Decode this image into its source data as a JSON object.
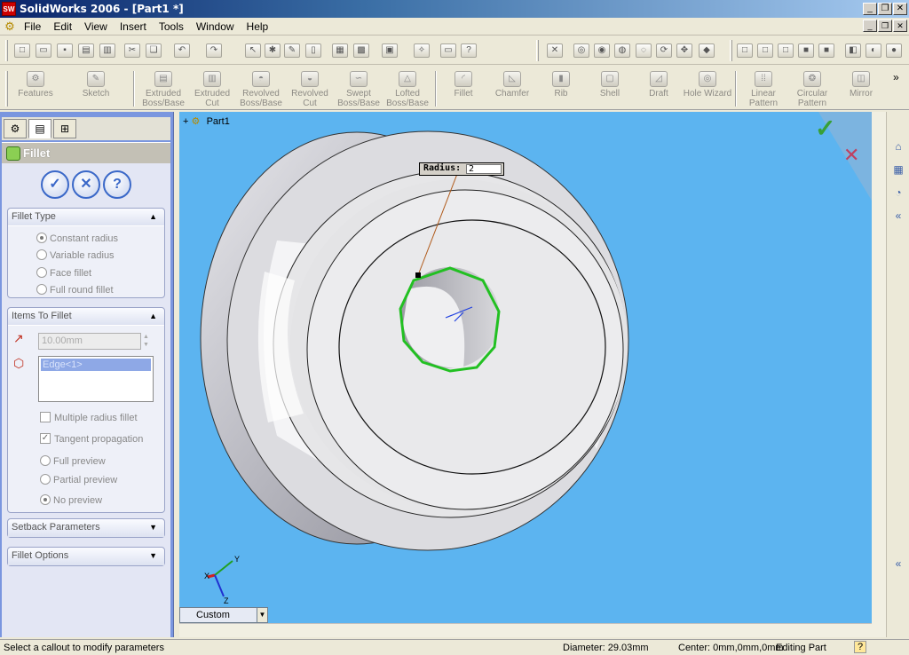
{
  "window": {
    "title": "SolidWorks 2006 - [Part1 *]",
    "app_icon": "SW"
  },
  "menu": [
    "File",
    "Edit",
    "View",
    "Insert",
    "Tools",
    "Window",
    "Help"
  ],
  "features_toolbar": [
    {
      "label": "Features"
    },
    {
      "label": "Sketch"
    },
    {
      "label": "Extruded Boss/Base"
    },
    {
      "label": "Extruded Cut"
    },
    {
      "label": "Revolved Boss/Base"
    },
    {
      "label": "Revolved Cut"
    },
    {
      "label": "Swept Boss/Base"
    },
    {
      "label": "Lofted Boss/Base"
    },
    {
      "label": "Fillet"
    },
    {
      "label": "Chamfer"
    },
    {
      "label": "Rib"
    },
    {
      "label": "Shell"
    },
    {
      "label": "Draft"
    },
    {
      "label": "Hole Wizard"
    },
    {
      "label": "Linear Pattern"
    },
    {
      "label": "Circular Pattern"
    },
    {
      "label": "Mirror"
    }
  ],
  "property_manager": {
    "title": "Fillet",
    "fillet_type": {
      "header": "Fillet Type",
      "options": [
        "Constant radius",
        "Variable radius",
        "Face fillet",
        "Full round fillet"
      ],
      "selected": "Constant radius"
    },
    "items_to_fillet": {
      "header": "Items To Fillet",
      "radius_value": "10.00mm",
      "edges": [
        "Edge<1>"
      ],
      "multiple_radius": "Multiple radius fillet",
      "tangent_propagation": "Tangent propagation",
      "preview_options": [
        "Full preview",
        "Partial preview",
        "No preview"
      ],
      "preview_selected": "No preview"
    },
    "setback": "Setback Parameters",
    "fillet_options": "Fillet Options"
  },
  "graphics": {
    "tree_root": "Part1",
    "callout_label": "Radius:",
    "callout_value": "2",
    "view_orientation": "Custom",
    "triad": {
      "x": "X",
      "y": "Y",
      "z": "Z"
    },
    "colors": {
      "background": "#5cb4f0",
      "selected_edge": "#22c022",
      "part": "#d8d8d8"
    }
  },
  "status": {
    "message": "Select a callout to modify parameters",
    "diameter": "Diameter: 29.03mm",
    "center": "Center: 0mm,0mm,0mm",
    "mode": "Editing Part",
    "help": "?"
  }
}
